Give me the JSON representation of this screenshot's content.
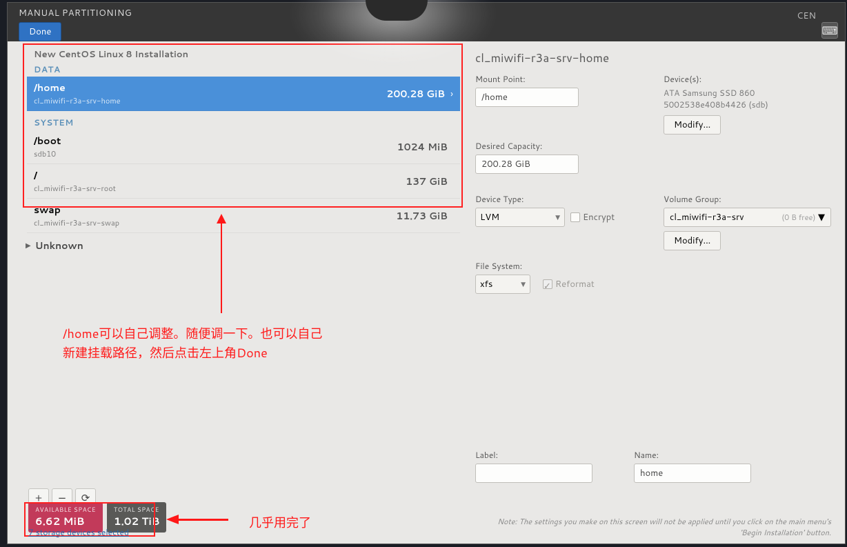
{
  "topbar": {
    "title": "MANUAL PARTITIONING",
    "done": "Done",
    "distro_hint": "CEN"
  },
  "scheme_title": "New CentOS Linux 8 Installation",
  "sections": {
    "data": "DATA",
    "system": "SYSTEM"
  },
  "partitions": {
    "data": [
      {
        "mount": "/home",
        "device": "cl_miwifi-r3a-srv-home",
        "size": "200.28 GiB"
      }
    ],
    "system": [
      {
        "mount": "/boot",
        "device": "sdb10",
        "size": "1024 MiB"
      },
      {
        "mount": "/",
        "device": "cl_miwifi-r3a-srv-root",
        "size": "137 GiB"
      },
      {
        "mount": "swap",
        "device": "cl_miwifi-r3a-srv-swap",
        "size": "11.73 GiB"
      }
    ]
  },
  "unknown_label": "Unknown",
  "toolbar": {
    "add": "+",
    "remove": "−",
    "reload": "⟳"
  },
  "space": {
    "avail_label": "AVAILABLE SPACE",
    "avail_value": "6.62 MiB",
    "total_label": "TOTAL SPACE",
    "total_value": "1.02 TiB"
  },
  "storage_link": "7 storage devices selected",
  "right": {
    "title": "cl_miwifi-r3a-srv-home",
    "mount_point_label": "Mount Point:",
    "mount_point_value": "/home",
    "desired_cap_label": "Desired Capacity:",
    "desired_cap_value": "200.28 GiB",
    "devices_label": "Device(s):",
    "device_line1": "ATA Samsung SSD 860",
    "device_line2": "5002538e408b4426 (sdb)",
    "modify_btn": "Modify...",
    "device_type_label": "Device Type:",
    "device_type_value": "LVM",
    "encrypt_label": "Encrypt",
    "vg_label": "Volume Group:",
    "vg_value": "cl_miwifi-r3a-srv",
    "vg_free": "(0 B free)",
    "fs_label": "File System:",
    "fs_value": "xfs",
    "reformat_label": "Reformat",
    "label_label": "Label:",
    "label_value": "",
    "name_label": "Name:",
    "name_value": "home",
    "note": "Note:  The settings you make on this screen will not be applied until you click on the main menu's 'Begin Installation' button."
  },
  "annotations": {
    "text1_line1": "/home可以自己调整。随便调一下。也可以自己",
    "text1_line2": "新建挂载路径，然后点击左上角Done",
    "text2": "几乎用完了"
  }
}
